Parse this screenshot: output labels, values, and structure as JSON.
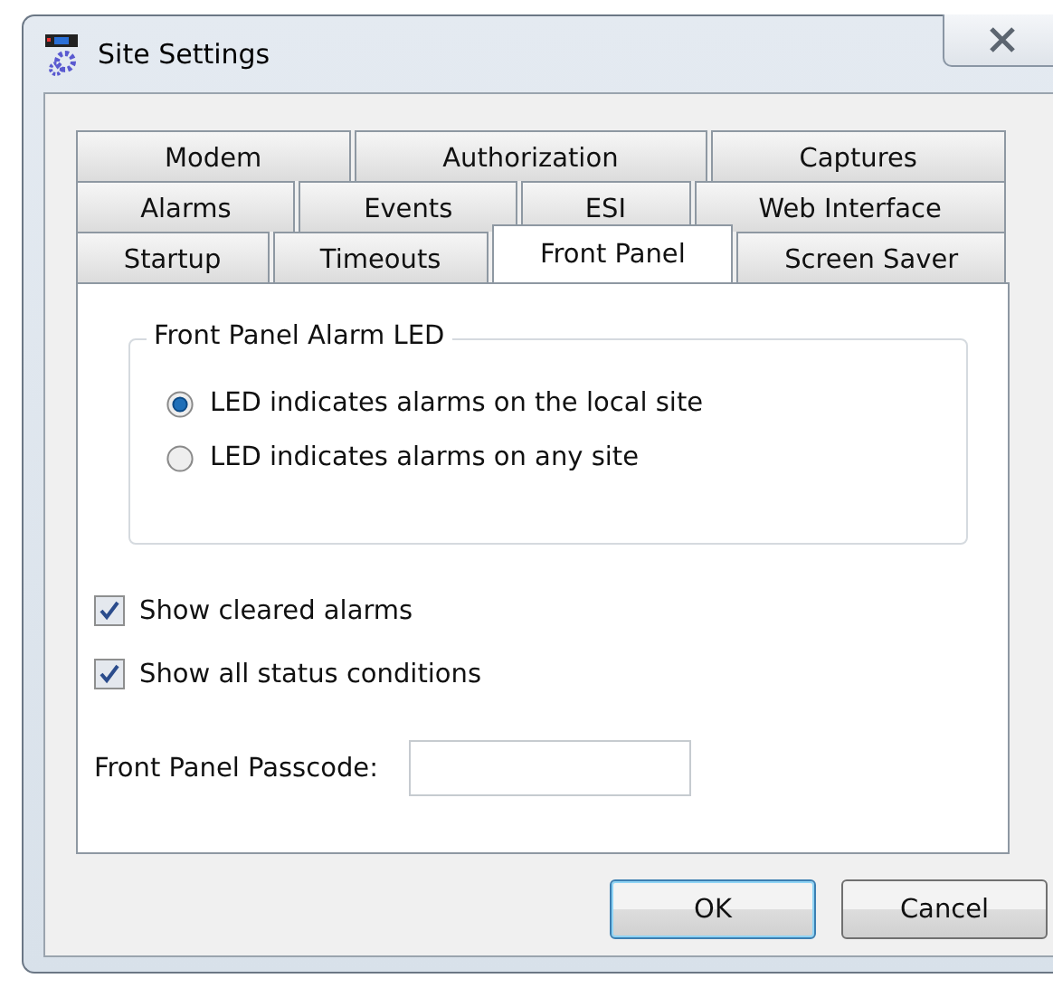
{
  "window": {
    "title": "Site Settings"
  },
  "tab_rows": [
    [
      {
        "label": "Modem",
        "selected": false
      },
      {
        "label": "Authorization",
        "selected": false
      },
      {
        "label": "Captures",
        "selected": false
      }
    ],
    [
      {
        "label": "Alarms",
        "selected": false
      },
      {
        "label": "Events",
        "selected": false
      },
      {
        "label": "ESI",
        "selected": false
      },
      {
        "label": "Web Interface",
        "selected": false
      }
    ],
    [
      {
        "label": "Startup",
        "selected": false
      },
      {
        "label": "Timeouts",
        "selected": false
      },
      {
        "label": "Front Panel",
        "selected": true
      },
      {
        "label": "Screen Saver",
        "selected": false
      }
    ]
  ],
  "group": {
    "title": "Front Panel Alarm LED",
    "options": [
      {
        "label": "LED indicates alarms on the local site",
        "selected": true
      },
      {
        "label": "LED indicates alarms on any site",
        "selected": false
      }
    ]
  },
  "checkboxes": [
    {
      "label": "Show cleared alarms",
      "checked": true
    },
    {
      "label": "Show all status conditions",
      "checked": true
    }
  ],
  "passcode": {
    "label": "Front Panel Passcode:"
  },
  "buttons": [
    {
      "label": "OK",
      "default": true
    },
    {
      "label": "Cancel",
      "default": false
    }
  ]
}
